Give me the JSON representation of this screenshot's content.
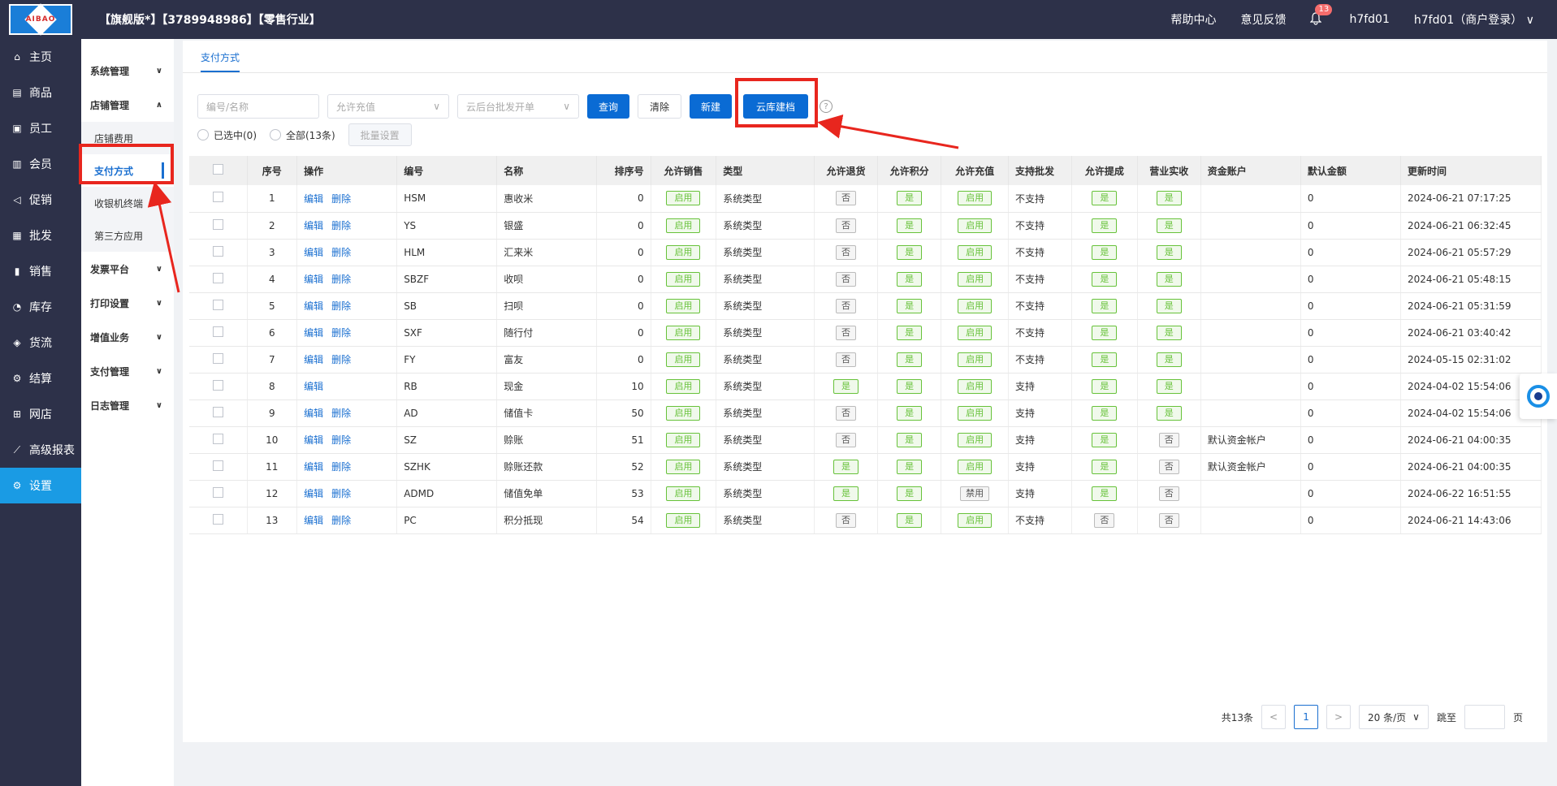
{
  "header": {
    "title": "【旗舰版*】【3789948986】【零售行业】",
    "help": "帮助中心",
    "feedback": "意见反馈",
    "notif_count": "13",
    "user": "h7fd01",
    "account": "h7fd01（商户登录）"
  },
  "sidebar": [
    {
      "label": "主页",
      "icon": "home-icon"
    },
    {
      "label": "商品",
      "icon": "goods-icon"
    },
    {
      "label": "员工",
      "icon": "staff-icon"
    },
    {
      "label": "会员",
      "icon": "member-icon"
    },
    {
      "label": "促销",
      "icon": "promo-icon"
    },
    {
      "label": "批发",
      "icon": "wholesale-icon"
    },
    {
      "label": "销售",
      "icon": "sales-icon"
    },
    {
      "label": "库存",
      "icon": "stock-icon"
    },
    {
      "label": "货流",
      "icon": "flow-icon"
    },
    {
      "label": "结算",
      "icon": "settle-icon"
    },
    {
      "label": "网店",
      "icon": "shop-icon"
    },
    {
      "label": "高级报表",
      "icon": "report-icon"
    },
    {
      "label": "设置",
      "icon": "settings-icon"
    }
  ],
  "subnav": {
    "g1": "系统管理",
    "g2": "店铺管理",
    "i1": "店铺费用",
    "i2": "支付方式",
    "i3": "收银机终端",
    "i4": "第三方应用",
    "g3": "发票平台",
    "g4": "打印设置",
    "g5": "增值业务",
    "g6": "支付管理",
    "g7": "日志管理"
  },
  "tab": "支付方式",
  "filters": {
    "code_placeholder": "编号/名称",
    "recharge_placeholder": "允许充值",
    "wholesale_placeholder": "云后台批发开单",
    "query": "查询",
    "clear": "清除",
    "new": "新建",
    "cloud": "云库建档",
    "selected": "已选中(0)",
    "all": "全部(13条)",
    "batch": "批量设置"
  },
  "columns": [
    "序号",
    "操作",
    "编号",
    "名称",
    "排序号",
    "允许销售",
    "类型",
    "允许退货",
    "允许积分",
    "允许充值",
    "支持批发",
    "允许提成",
    "营业实收",
    "资金账户",
    "默认金额",
    "更新时间"
  ],
  "edit": "编辑",
  "delete": "删除",
  "rows": [
    {
      "no": "1",
      "del": true,
      "code": "HSM",
      "name": "惠收米",
      "sort": "0",
      "sale": "启用",
      "type": "系统类型",
      "ret": "否",
      "pts": "是",
      "rec": "启用",
      "ws": "不支持",
      "com": "是",
      "act": "是",
      "acct": "",
      "amt": "0",
      "time": "2024-06-21 07:17:25"
    },
    {
      "no": "2",
      "del": true,
      "code": "YS",
      "name": "银盛",
      "sort": "0",
      "sale": "启用",
      "type": "系统类型",
      "ret": "否",
      "pts": "是",
      "rec": "启用",
      "ws": "不支持",
      "com": "是",
      "act": "是",
      "acct": "",
      "amt": "0",
      "time": "2024-06-21 06:32:45"
    },
    {
      "no": "3",
      "del": true,
      "code": "HLM",
      "name": "汇来米",
      "sort": "0",
      "sale": "启用",
      "type": "系统类型",
      "ret": "否",
      "pts": "是",
      "rec": "启用",
      "ws": "不支持",
      "com": "是",
      "act": "是",
      "acct": "",
      "amt": "0",
      "time": "2024-06-21 05:57:29"
    },
    {
      "no": "4",
      "del": true,
      "code": "SBZF",
      "name": "收呗",
      "sort": "0",
      "sale": "启用",
      "type": "系统类型",
      "ret": "否",
      "pts": "是",
      "rec": "启用",
      "ws": "不支持",
      "com": "是",
      "act": "是",
      "acct": "",
      "amt": "0",
      "time": "2024-06-21 05:48:15"
    },
    {
      "no": "5",
      "del": true,
      "code": "SB",
      "name": "扫呗",
      "sort": "0",
      "sale": "启用",
      "type": "系统类型",
      "ret": "否",
      "pts": "是",
      "rec": "启用",
      "ws": "不支持",
      "com": "是",
      "act": "是",
      "acct": "",
      "amt": "0",
      "time": "2024-06-21 05:31:59"
    },
    {
      "no": "6",
      "del": true,
      "code": "SXF",
      "name": "随行付",
      "sort": "0",
      "sale": "启用",
      "type": "系统类型",
      "ret": "否",
      "pts": "是",
      "rec": "启用",
      "ws": "不支持",
      "com": "是",
      "act": "是",
      "acct": "",
      "amt": "0",
      "time": "2024-06-21 03:40:42"
    },
    {
      "no": "7",
      "del": true,
      "code": "FY",
      "name": "富友",
      "sort": "0",
      "sale": "启用",
      "type": "系统类型",
      "ret": "否",
      "pts": "是",
      "rec": "启用",
      "ws": "不支持",
      "com": "是",
      "act": "是",
      "acct": "",
      "amt": "0",
      "time": "2024-05-15 02:31:02"
    },
    {
      "no": "8",
      "del": false,
      "code": "RB",
      "name": "现金",
      "sort": "10",
      "sale": "启用",
      "type": "系统类型",
      "ret": "是",
      "pts": "是",
      "rec": "启用",
      "ws": "支持",
      "com": "是",
      "act": "是",
      "acct": "",
      "amt": "0",
      "time": "2024-04-02 15:54:06"
    },
    {
      "no": "9",
      "del": true,
      "code": "AD",
      "name": "储值卡",
      "sort": "50",
      "sale": "启用",
      "type": "系统类型",
      "ret": "否",
      "pts": "是",
      "rec": "启用",
      "ws": "支持",
      "com": "是",
      "act": "是",
      "acct": "",
      "amt": "0",
      "time": "2024-04-02 15:54:06"
    },
    {
      "no": "10",
      "del": true,
      "code": "SZ",
      "name": "赊账",
      "sort": "51",
      "sale": "启用",
      "type": "系统类型",
      "ret": "否",
      "pts": "是",
      "rec": "启用",
      "ws": "支持",
      "com": "是",
      "act": "否",
      "acct": "默认资金帐户",
      "amt": "0",
      "time": "2024-06-21 04:00:35"
    },
    {
      "no": "11",
      "del": true,
      "code": "SZHK",
      "name": "赊账还款",
      "sort": "52",
      "sale": "启用",
      "type": "系统类型",
      "ret": "是",
      "pts": "是",
      "rec": "启用",
      "ws": "支持",
      "com": "是",
      "act": "否",
      "acct": "默认资金帐户",
      "amt": "0",
      "time": "2024-06-21 04:00:35"
    },
    {
      "no": "12",
      "del": true,
      "code": "ADMD",
      "name": "储值免单",
      "sort": "53",
      "sale": "启用",
      "type": "系统类型",
      "ret": "是",
      "pts": "是",
      "rec": "禁用",
      "ws": "支持",
      "com": "是",
      "act": "否",
      "acct": "",
      "amt": "0",
      "time": "2024-06-22 16:51:55"
    },
    {
      "no": "13",
      "del": true,
      "code": "PC",
      "name": "积分抵现",
      "sort": "54",
      "sale": "启用",
      "type": "系统类型",
      "ret": "否",
      "pts": "是",
      "rec": "启用",
      "ws": "不支持",
      "com": "否",
      "act": "否",
      "acct": "",
      "amt": "0",
      "time": "2024-06-21 14:43:06"
    }
  ],
  "pager": {
    "total": "共13条",
    "page": "1",
    "prev": "<",
    "next": ">",
    "size": "20 条/页",
    "jump": "跳至",
    "unit": "页"
  }
}
